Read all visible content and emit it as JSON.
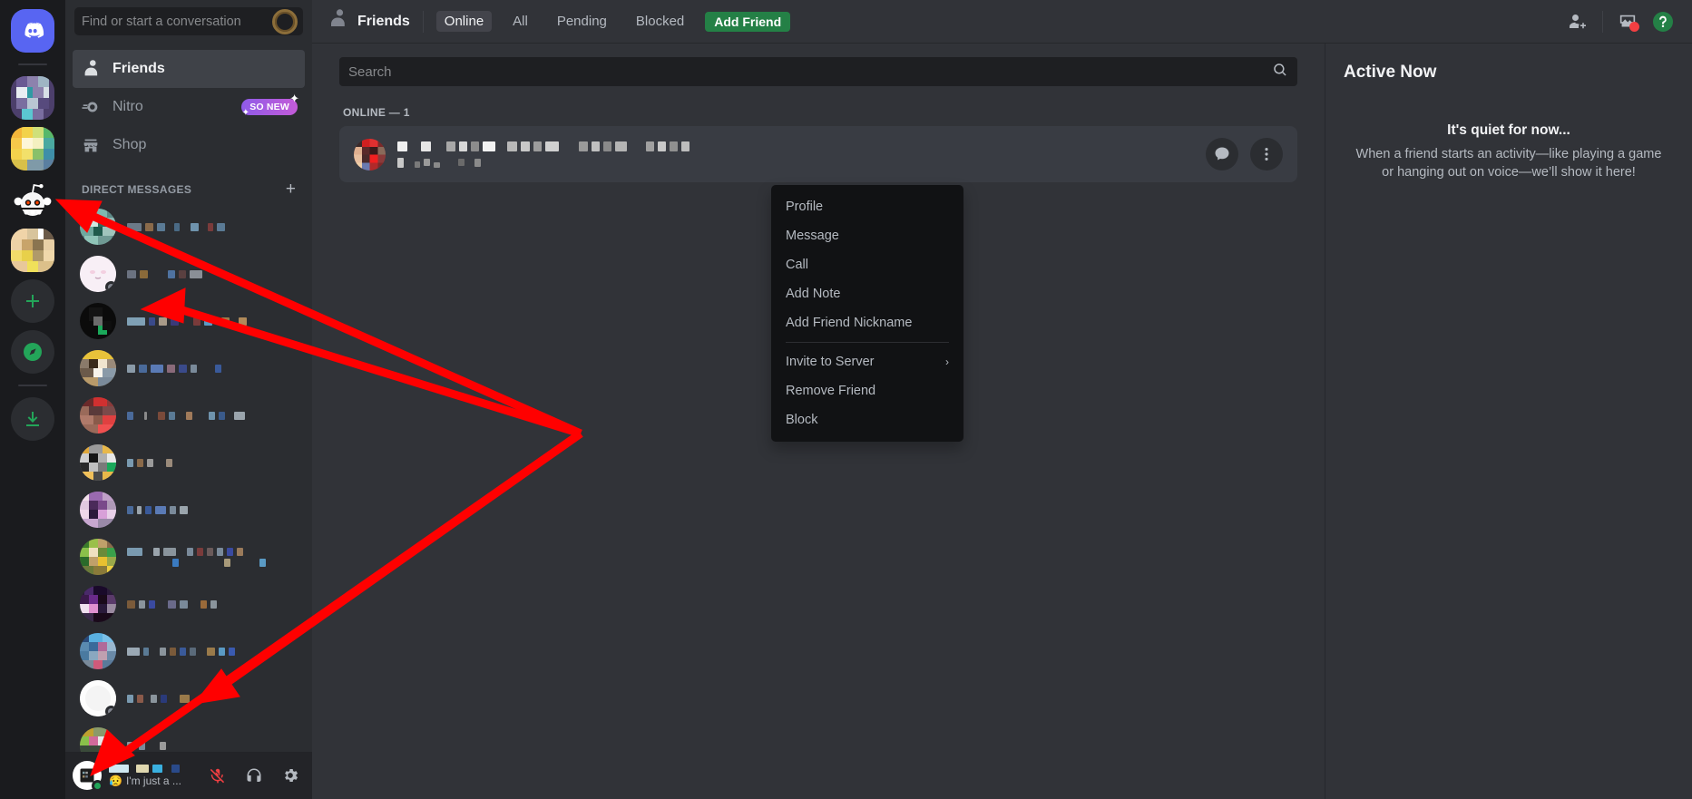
{
  "rail": {
    "home_tooltip": "Direct Messages",
    "items": [
      {
        "name": "server-pixel-1"
      },
      {
        "name": "server-pixel-2"
      },
      {
        "name": "server-reddit"
      },
      {
        "name": "server-pixel-3"
      }
    ],
    "add_server_label": "+",
    "explore_label": "Explore Discoverable Servers",
    "download_label": "Download Apps"
  },
  "sidebar": {
    "search_placeholder": "Find or start a conversation",
    "nav": [
      {
        "label": "Friends",
        "icon": "friends-icon",
        "active": true
      },
      {
        "label": "Nitro",
        "icon": "nitro-icon",
        "badge": "SO NEW",
        "active": false
      },
      {
        "label": "Shop",
        "icon": "shop-icon",
        "active": false
      }
    ],
    "dm_header": "DIRECT MESSAGES",
    "dm_add": "+",
    "dm_count": 13
  },
  "user_panel": {
    "status_text": "I'm just a ...",
    "status_emoji": "😥",
    "mic_icon": "microphone-muted-icon",
    "headset_icon": "headphones-icon",
    "settings_icon": "gear-icon"
  },
  "topbar": {
    "title": "Friends",
    "tabs": [
      {
        "label": "Online",
        "selected": true
      },
      {
        "label": "All",
        "selected": false
      },
      {
        "label": "Pending",
        "selected": false
      },
      {
        "label": "Blocked",
        "selected": false
      }
    ],
    "add_friend_label": "Add Friend",
    "right_icons": [
      "new-group-dm-icon",
      "inbox-icon",
      "help-icon"
    ]
  },
  "main": {
    "search_placeholder": "Search",
    "online_label": "ONLINE — 1",
    "friends": [
      {
        "name_redacted": true,
        "message_icon": "message-icon",
        "more_icon": "more-vertical-icon"
      }
    ]
  },
  "context_menu": {
    "items": [
      {
        "label": "Profile",
        "submenu": false
      },
      {
        "label": "Message",
        "submenu": false
      },
      {
        "label": "Call",
        "submenu": false
      },
      {
        "label": "Add Note",
        "submenu": false
      },
      {
        "label": "Add Friend Nickname",
        "submenu": false
      },
      {
        "separator": true
      },
      {
        "label": "Invite to Server",
        "submenu": true
      },
      {
        "label": "Remove Friend",
        "submenu": false
      },
      {
        "label": "Block",
        "submenu": false
      }
    ],
    "chevron": "›"
  },
  "active_now": {
    "title": "Active Now",
    "empty_title": "It's quiet for now...",
    "empty_body": "When a friend starts an activity—like playing a game or hanging out on voice—we’ll show it here!"
  },
  "colors": {
    "brand": "#5865f2",
    "green": "#248046",
    "nitro_badge_start": "#8f5be8",
    "nitro_badge_end": "#c45bd8",
    "sidebar_bg": "#2b2d31",
    "main_bg": "#313338",
    "rail_bg": "#1a1b1e",
    "menu_bg": "#111214",
    "annotation": "#ff0000"
  }
}
